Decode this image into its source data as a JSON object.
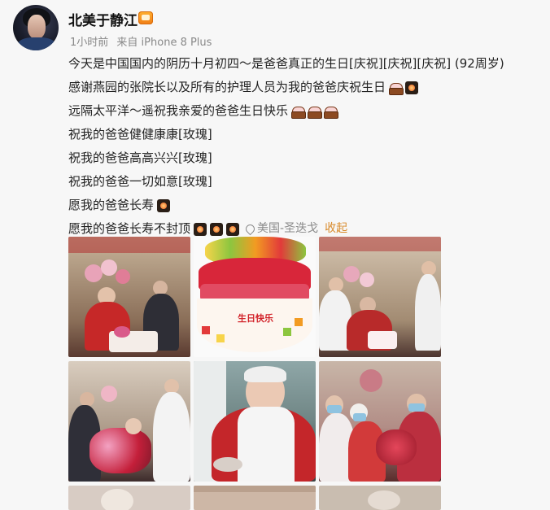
{
  "post": {
    "username": "北美于静江",
    "time": "1小时前",
    "source": "来自 iPhone 8 Plus",
    "lines": [
      "今天是中国国内的阴历十月初四～是爸爸真正的生日[庆祝][庆祝][庆祝]  (92周岁)",
      "感谢燕园的张院长以及所有的护理人员为我的爸爸庆祝生日",
      "远隔太平洋～遥祝我亲爱的爸爸生日快乐",
      "祝我的爸爸健健康康[玫瑰]",
      "祝我的爸爸高高兴兴[玫瑰]",
      "祝我的爸爸一切如意[玫瑰]",
      "愿我的爸爸长寿",
      "愿我的爸爸长寿不封顶"
    ],
    "location": "美国-圣迭戈",
    "collapse_label": "收起",
    "cake_text": "生日快乐"
  },
  "icons": {
    "vip": "vip-badge-icon",
    "cake": "birthday-cake-icon",
    "fire": "fireworks-icon",
    "location": "location-pin-icon"
  },
  "colors": {
    "link_gray": "#8a8a8a",
    "collapse_orange": "#d88a2a",
    "vip_orange": "#f07c16"
  }
}
